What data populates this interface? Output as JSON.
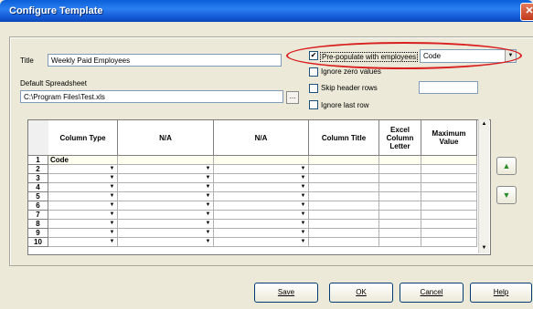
{
  "window": {
    "title": "Configure Template",
    "close_glyph": "✕"
  },
  "form": {
    "title_label": "Title",
    "title_value": "Weekly Paid Employees",
    "spreadsheet_label": "Default Spreadsheet",
    "spreadsheet_value": "C:\\Program Files\\Test.xls",
    "browse_label": "..."
  },
  "options": {
    "prepopulate": {
      "label": "Pre-populate with employees",
      "checked": true
    },
    "ignore_zero": {
      "label": "Ignore zero values",
      "checked": false
    },
    "skip_header": {
      "label": "Skip header rows",
      "checked": false,
      "value": ""
    },
    "ignore_last": {
      "label": "Ignore last row",
      "checked": false
    },
    "populate_select": {
      "value": "Code"
    }
  },
  "grid": {
    "headers": [
      "Column Type",
      "N/A",
      "N/A",
      "Column Title",
      "Excel Column Letter",
      "Maximum Value"
    ],
    "row_numbers": [
      "1",
      "2",
      "3",
      "4",
      "5",
      "6",
      "7",
      "8",
      "9",
      "10"
    ],
    "row1_col1": "Code"
  },
  "icons": {
    "move_up": "up-arrow-icon",
    "move_down": "down-arrow-icon",
    "accent_green": "#2a8c2a",
    "highlight_color": "#d82020"
  },
  "buttons": {
    "save": "Save",
    "ok": "OK",
    "cancel": "Cancel",
    "help": "Help"
  }
}
